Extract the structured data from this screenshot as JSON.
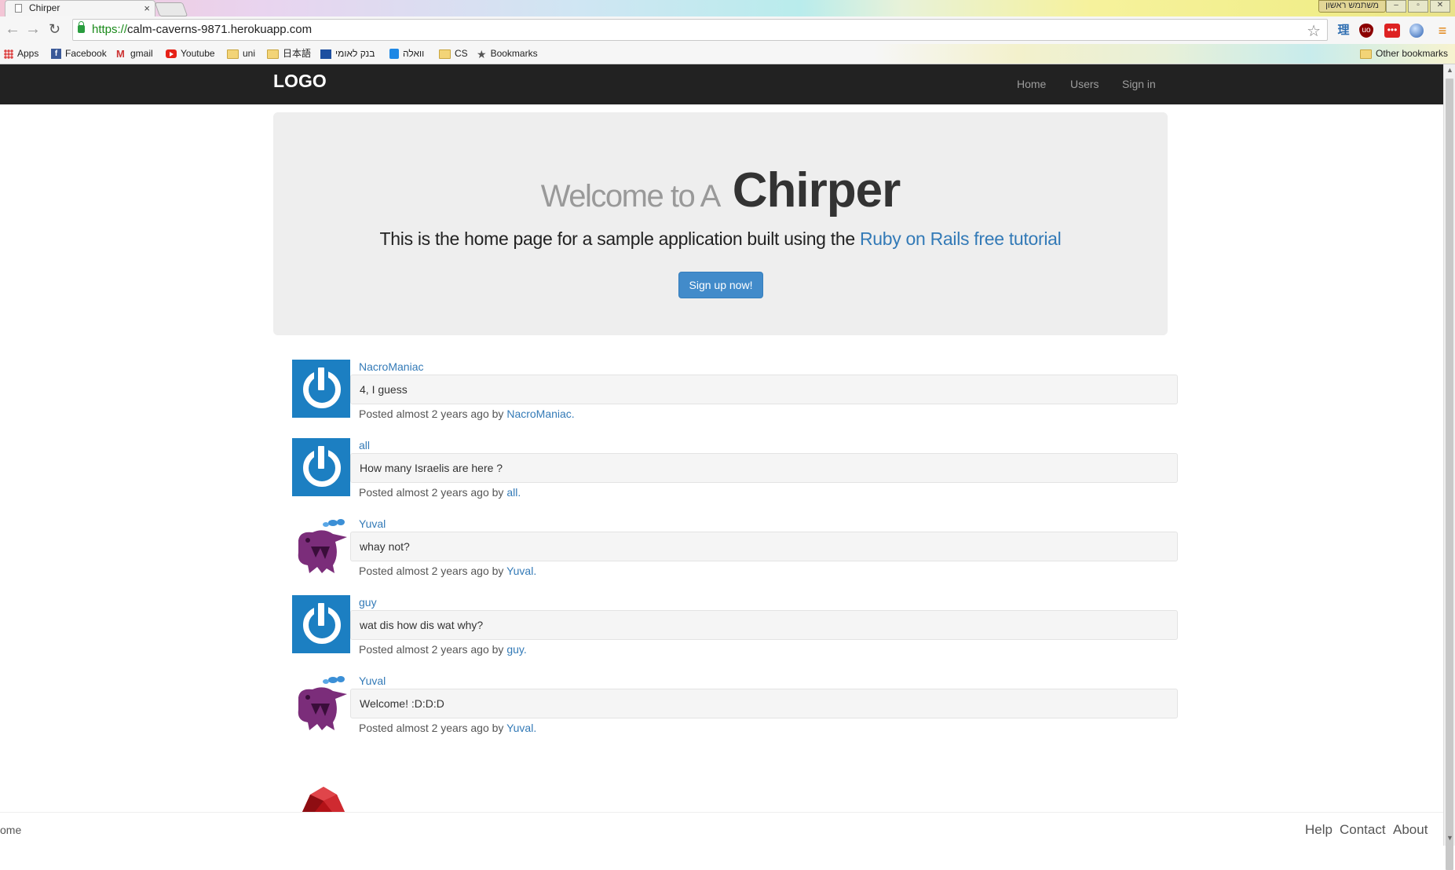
{
  "browser": {
    "tab_title": "Chirper",
    "tab_close": "×",
    "url_scheme": "https://",
    "url_host": "calm-caverns-9871.herokuapp.com",
    "window_user": "משתמש ראשון",
    "bookmarks": [
      {
        "label": "Apps",
        "icon": "apps-grid-icon"
      },
      {
        "label": "Facebook",
        "icon": "facebook-icon"
      },
      {
        "label": "gmail",
        "icon": "gmail-icon"
      },
      {
        "label": "Youtube",
        "icon": "youtube-icon"
      },
      {
        "label": "uni",
        "icon": "folder-icon"
      },
      {
        "label": "日本語",
        "icon": "folder-icon"
      },
      {
        "label": "בנק לאומי",
        "icon": "bank-icon"
      },
      {
        "label": "וואלה",
        "icon": "walla-icon"
      },
      {
        "label": "CS",
        "icon": "folder-icon"
      },
      {
        "label": "Bookmarks",
        "icon": "star-icon"
      }
    ],
    "other_bookmarks": "Other bookmarks"
  },
  "navbar": {
    "logo": "LOGO",
    "links": [
      "Home",
      "Users",
      "Sign in"
    ]
  },
  "hero": {
    "welcome_prefix": "Welcome to A",
    "brand": "Chirper",
    "intro_text": "This is the home page for a sample application built using the ",
    "intro_link": "Ruby on Rails free tutorial",
    "signup_label": "Sign up now!"
  },
  "feed": [
    {
      "user": "NacroManiac",
      "content": "4, I guess",
      "meta_prefix": "Posted almost 2 years ago by ",
      "meta_user": "NacroManiac.",
      "avatar": "power-icon"
    },
    {
      "user": "all",
      "content": "How many Israelis are here ?",
      "meta_prefix": "Posted almost 2 years ago by ",
      "meta_user": "all.",
      "avatar": "power-icon"
    },
    {
      "user": "Yuval",
      "content": "whay not?",
      "meta_prefix": "Posted almost 2 years ago by ",
      "meta_user": "Yuval.",
      "avatar": "monster-icon"
    },
    {
      "user": "guy",
      "content": "wat dis how dis wat why?",
      "meta_prefix": "Posted almost 2 years ago by ",
      "meta_user": "guy.",
      "avatar": "power-icon"
    },
    {
      "user": "Yuval",
      "content": "Welcome! :D:D:D",
      "meta_prefix": "Posted almost 2 years ago by ",
      "meta_user": "Yuval.",
      "avatar": "monster-icon"
    }
  ],
  "footer": {
    "left_text": "ome",
    "links": [
      "Help",
      "Contact",
      "About"
    ]
  },
  "colors": {
    "navbar_bg": "#222222",
    "link": "#337ab7",
    "button": "#428bca",
    "jumbotron_bg": "#eeeeee"
  }
}
